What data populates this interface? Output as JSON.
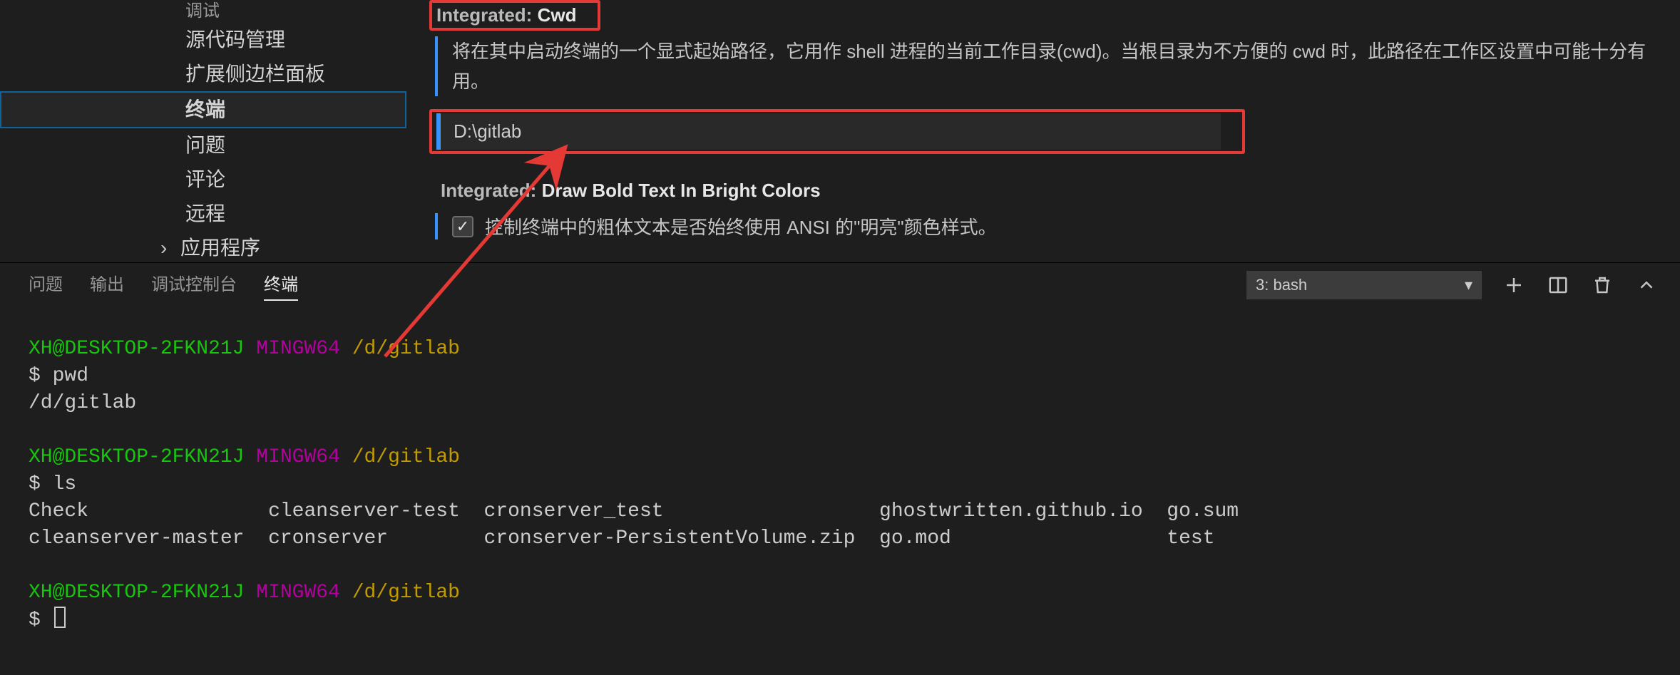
{
  "sidebar": {
    "debug": "调试",
    "items": [
      "源代码管理",
      "扩展侧边栏面板",
      "终端",
      "问题",
      "评论",
      "远程"
    ],
    "active_index": 2,
    "apps": "应用程序"
  },
  "settings": {
    "cwd": {
      "prefix": "Integrated: ",
      "name": "Cwd",
      "desc": "将在其中启动终端的一个显式起始路径，它用作 shell 进程的当前工作目录(cwd)。当根目录为不方便的 cwd 时，此路径在工作区设置中可能十分有用。",
      "value": "D:\\gitlab"
    },
    "bold": {
      "prefix": "Integrated: ",
      "name": "Draw Bold Text In Bright Colors",
      "label": "控制终端中的粗体文本是否始终使用 ANSI 的\"明亮\"颜色样式。",
      "checked": true
    }
  },
  "panel": {
    "tabs": [
      "问题",
      "输出",
      "调试控制台",
      "终端"
    ],
    "active_index": 3,
    "terminal_select": "3: bash"
  },
  "terminal": {
    "user": "XH@DESKTOP-2FKN21J",
    "env": "MINGW64",
    "path": "/d/gitlab",
    "cmd1": "pwd",
    "out1": "/d/gitlab",
    "cmd2": "ls",
    "ls": {
      "c1a": "Check",
      "c2a": "cleanserver-test",
      "c3a": "cronserver_test",
      "c4a": "ghostwritten.github.io",
      "c5a": "go.sum",
      "c1b": "cleanserver-master",
      "c2b": "cronserver",
      "c3b": "cronserver-PersistentVolume.zip",
      "c4b": "go.mod",
      "c5b": "test"
    }
  }
}
